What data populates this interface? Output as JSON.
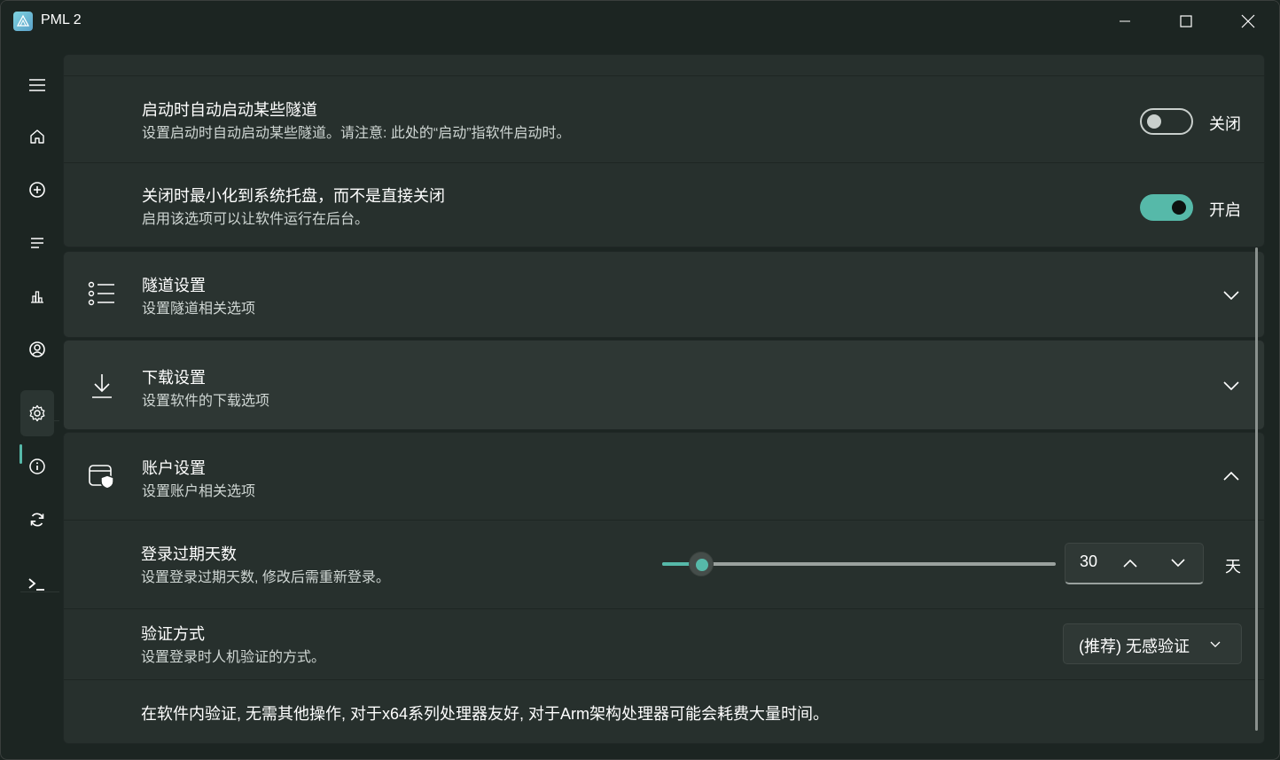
{
  "window": {
    "title": "PML 2",
    "controls": [
      "minimize",
      "maximize",
      "close"
    ]
  },
  "sidebar": {
    "items": [
      {
        "icon": "hamburger-menu-icon"
      },
      {
        "icon": "home-icon"
      },
      {
        "icon": "add-circle-icon"
      },
      {
        "icon": "list-icon"
      },
      {
        "icon": "bar-chart-icon"
      },
      {
        "icon": "user-circle-icon"
      },
      {
        "icon": "settings-gear-icon",
        "active": true
      },
      {
        "icon": "info-icon"
      },
      {
        "icon": "sync-icon"
      },
      {
        "icon": "terminal-icon"
      }
    ],
    "accent": "#56b9a9"
  },
  "settings": {
    "autostart": {
      "title": "启动时自动启动某些隧道",
      "subtitle": "设置启动时自动启动某些隧道。请注意: 此处的“启动”指软件启动时。",
      "state": "关闭"
    },
    "minimize_tray": {
      "title": "关闭时最小化到系统托盘，而不是直接关闭",
      "subtitle": "启用该选项可以让软件运行在后台。",
      "state": "开启"
    },
    "tunnel": {
      "title": "隧道设置",
      "subtitle": "设置隧道相关选项"
    },
    "download": {
      "title": "下载设置",
      "subtitle": "设置软件的下载选项"
    },
    "account": {
      "title": "账户设置",
      "subtitle": "设置账户相关选项",
      "login_expiry": {
        "title": "登录过期天数",
        "subtitle": "设置登录过期天数, 修改后需重新登录。",
        "value": "30",
        "unit": "天",
        "slider_fraction": 0.1
      },
      "verify": {
        "title": "验证方式",
        "subtitle": "设置登录时人机验证的方式。",
        "selected": "(推荐) 无感验证"
      },
      "note": "在软件内验证, 无需其他操作, 对于x64系列处理器友好, 对于Arm架构处理器可能会耗费大量时间。"
    }
  }
}
